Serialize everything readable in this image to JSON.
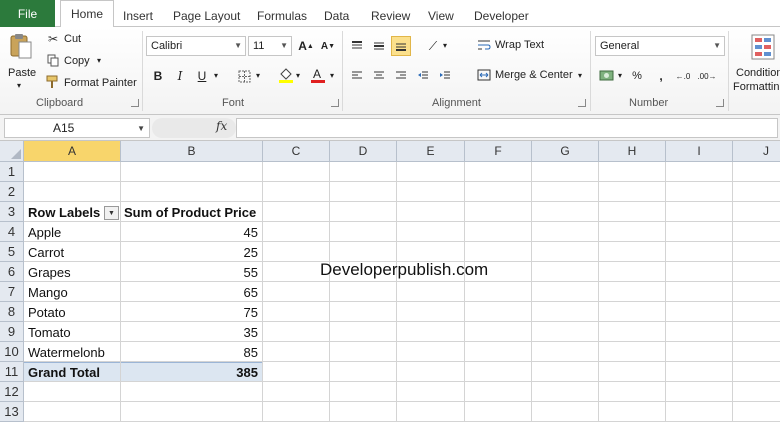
{
  "tabs": {
    "file": "File",
    "home": "Home",
    "insert": "Insert",
    "page_layout": "Page Layout",
    "formulas": "Formulas",
    "data": "Data",
    "review": "Review",
    "view": "View",
    "developer": "Developer"
  },
  "ribbon": {
    "clipboard": {
      "paste": "Paste",
      "cut": "Cut",
      "copy": "Copy",
      "format_painter": "Format Painter",
      "label": "Clipboard"
    },
    "font": {
      "name": "Calibri",
      "size": "11",
      "bold": "B",
      "italic": "I",
      "underline": "U",
      "label": "Font"
    },
    "alignment": {
      "wrap_text": "Wrap Text",
      "merge_center": "Merge & Center",
      "label": "Alignment"
    },
    "number": {
      "format": "General",
      "label": "Number"
    },
    "styles": {
      "conditional": "Condition",
      "formatting": "Formattin"
    }
  },
  "formula_bar": {
    "name_box": "A15",
    "fx": "fx",
    "value": ""
  },
  "columns": [
    "A",
    "B",
    "C",
    "D",
    "E",
    "F",
    "G",
    "H",
    "I",
    "J"
  ],
  "rows": [
    "1",
    "2",
    "3",
    "4",
    "5",
    "6",
    "7",
    "8",
    "9",
    "10",
    "11",
    "12",
    "13"
  ],
  "pivot": {
    "header_label": "Row Labels",
    "header_value": "Sum of Product Price",
    "items": [
      {
        "label": "Apple",
        "value": "45"
      },
      {
        "label": "Carrot",
        "value": "25"
      },
      {
        "label": "Grapes",
        "value": "55"
      },
      {
        "label": "Mango",
        "value": "65"
      },
      {
        "label": "Potato",
        "value": "75"
      },
      {
        "label": "Tomato",
        "value": "35"
      },
      {
        "label": "Watermelonb",
        "value": "85"
      }
    ],
    "total_label": "Grand Total",
    "total_value": "385"
  },
  "watermark": "Developerpublish.com",
  "colors": {
    "file_tab": "#2c7a3c",
    "selected_col_header": "#f8d56b",
    "total_row": "#dce6f1"
  }
}
